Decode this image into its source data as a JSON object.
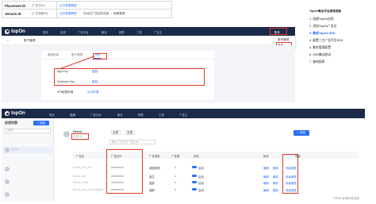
{
  "id_table": {
    "placement_key": "Placement ID",
    "placement_sub": "(广告位ID)",
    "placement_link": "点击查看教程",
    "scenario_key": "Senario ID",
    "scenario_sub": "(广告场景ID)",
    "scenario_link": "点击查看教程",
    "scenario_desc": "在对应广告位的右侧 → 场景管理"
  },
  "panel1": {
    "logo": "topOn",
    "nav": [
      "首页",
      "应用",
      "广告平台",
      "聚合",
      "报表",
      "工具",
      "广告主"
    ],
    "account_label": "账户管理",
    "user": "账号",
    "back_icon": "back-icon",
    "tabs": [
      "基础信息",
      "账户管理",
      "Key"
    ],
    "active_tab": "Key",
    "fields": [
      {
        "label": "App Key",
        "value": "复制"
      },
      {
        "label": "Publisher Key",
        "value": "复制"
      },
      {
        "label": "API权限申请",
        "value": "点击申请"
      }
    ],
    "dropdown": {
      "item1": "账号管理",
      "item2": "退出"
    }
  },
  "steps": {
    "title": "TopOn聚合平台使用流程",
    "items": [
      {
        "n": "1.",
        "text": "创建TopOn应用"
      },
      {
        "n": "2.",
        "text": "添加TopOn广告位"
      },
      {
        "n": "3.",
        "text": "集成TopOn SDK"
      },
      {
        "n": "4.",
        "text": "配置三方广告平台SDK"
      },
      {
        "n": "5.",
        "text": "聚合管理配置"
      },
      {
        "n": "6.",
        "text": "SDK集成测试"
      },
      {
        "n": "7.",
        "text": "查询报表"
      }
    ]
  },
  "panel2": {
    "logo": "topOn",
    "nav": [
      "首页",
      "应用",
      "广告平台",
      "聚合",
      "报表",
      "工具",
      "广告主"
    ],
    "side_title": "应用列表",
    "side_button": "+ 添加",
    "side_search": "搜索",
    "side_apps": [
      "Demo",
      "",
      "",
      ""
    ],
    "app_name": "Demo",
    "app_id": "应用ID",
    "filter1": "全部",
    "filter2": "全部",
    "search_placeholder": "输入广告位/广告位ID",
    "add_button": "+ 添加",
    "columns": [
      "广告位",
      "广告位ID",
      "广告类型",
      "广告源",
      "状态",
      "操作",
      "场景"
    ],
    "rows": [
      {
        "name": "Demo_RV_All",
        "type": "激励视频",
        "src": "1",
        "state": "启用",
        "op": "编辑",
        "op2": "删除",
        "scene": "场景管理"
      },
      {
        "name": "Demo_all",
        "type": "原生",
        "src": "1",
        "state": "启用",
        "op": "编辑",
        "op2": "删除",
        "scene": "场景管理"
      },
      {
        "name": "Demo_Inter",
        "type": "插屏",
        "src": "1",
        "state": "启用",
        "op": "编辑",
        "op2": "删除",
        "scene": "场景管理"
      },
      {
        "name": "Demo_test_Interstgrial",
        "type": "插屏",
        "src": "1",
        "state": "启用",
        "op": "编辑",
        "op2": "删除",
        "scene": "场景管理"
      }
    ]
  },
  "watermark": "CSDN @凛冬将至啦",
  "colors": {
    "nav": "#1b2a48",
    "accent": "#2a6ef7",
    "highlight": "#e23a2e"
  }
}
